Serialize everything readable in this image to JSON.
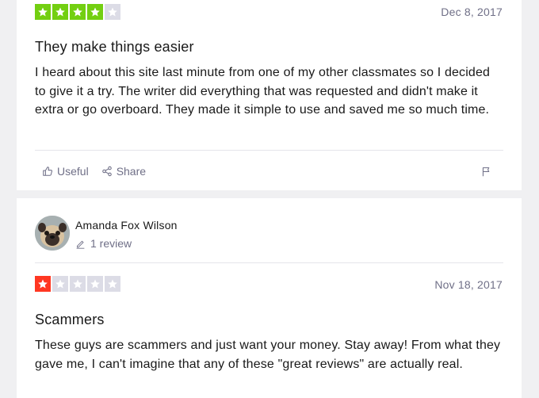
{
  "reviews": [
    {
      "rating": 4,
      "star_color": "#73cf11",
      "date": "Dec 8, 2017",
      "title": "They make things easier",
      "body": "I heard about this site last minute from one of my other classmates so I decided to give it a try. The writer did everything that was requested and didn't make it extra or go overboard. They made it simple to use and saved me so much time.",
      "actions": {
        "useful_label": "Useful",
        "share_label": "Share"
      }
    },
    {
      "reviewer": {
        "name": "Amanda Fox Wilson",
        "review_count": "1 review"
      },
      "rating": 1,
      "star_color": "#ff3722",
      "date": "Nov 18, 2017",
      "title": "Scammers",
      "body": "These guys are scammers and just want your money. Stay away! From what they gave me, I can't imagine that any of these \"great reviews\" are actually real."
    }
  ],
  "icons": {
    "star": "star-icon",
    "useful": "thumbs-up-icon",
    "share": "share-icon",
    "flag": "flag-icon",
    "review_count": "pencil-icon"
  }
}
